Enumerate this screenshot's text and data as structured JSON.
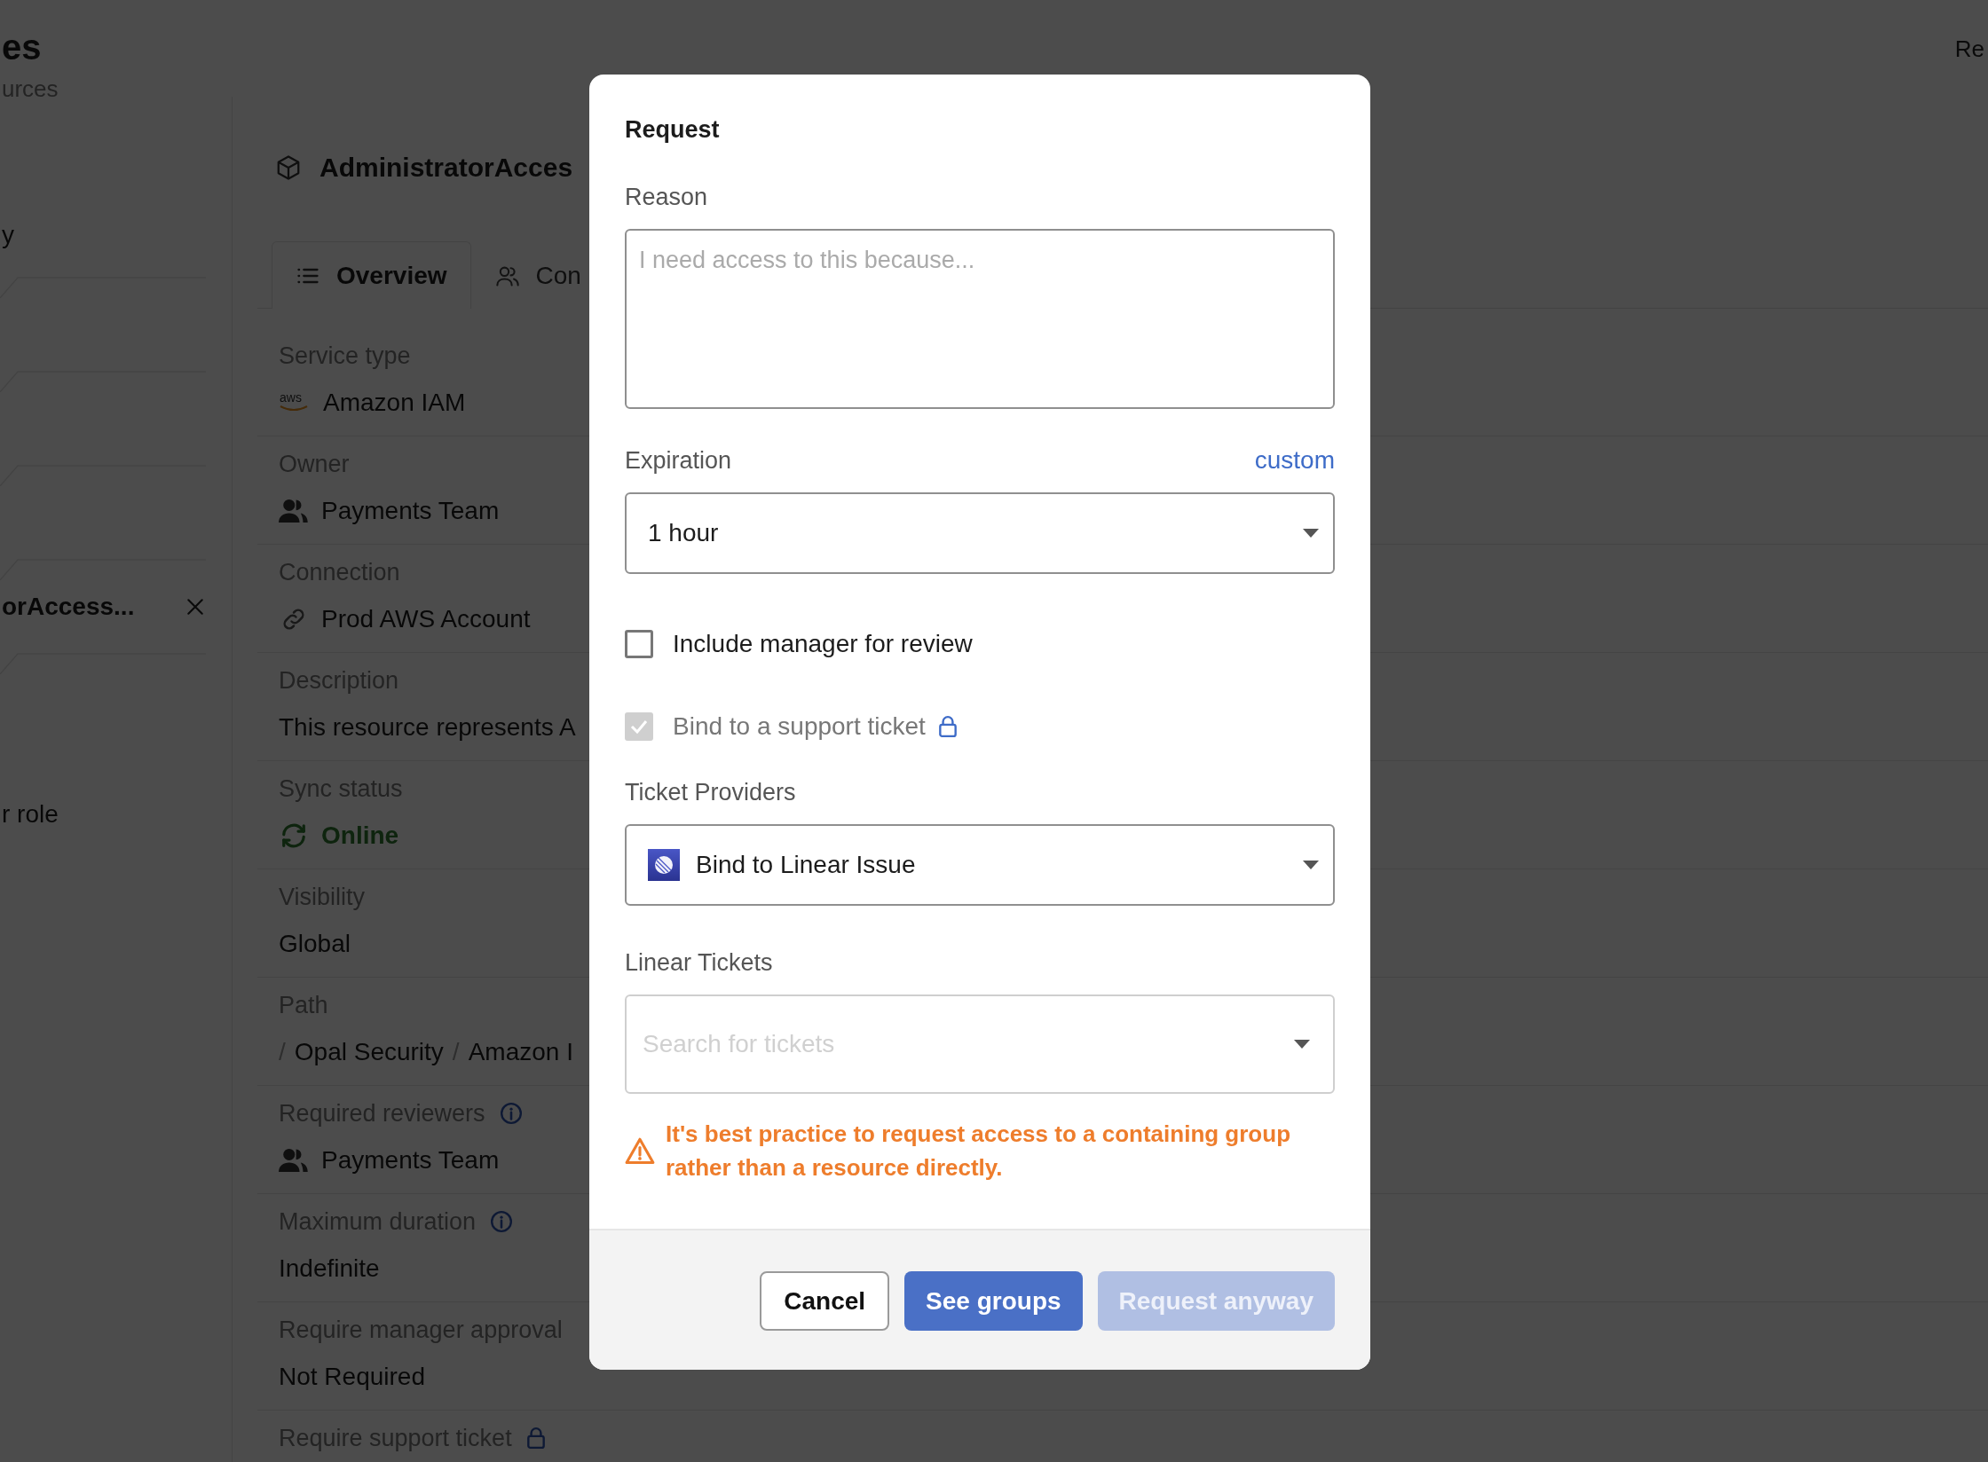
{
  "header": {
    "title": "es",
    "subtitle": "urces",
    "top_right": "Re"
  },
  "sidebar": {
    "items": [
      {
        "kind": "text",
        "label": "y"
      },
      {
        "kind": "branch"
      },
      {
        "kind": "branch"
      },
      {
        "kind": "branch"
      },
      {
        "kind": "branch",
        "label": "orAccess...",
        "selected": true
      },
      {
        "kind": "branch"
      },
      {
        "kind": "text",
        "label": "r role"
      }
    ]
  },
  "detail": {
    "title": "AdministratorAcces",
    "tabs": [
      {
        "label": "Overview",
        "selected": true
      },
      {
        "label": "Con",
        "selected": false
      }
    ],
    "fields": [
      {
        "kind": "service",
        "label": "Service type",
        "logo_text": "aws",
        "value": "Amazon IAM"
      },
      {
        "kind": "team",
        "label": "Owner",
        "value": "Payments Team"
      },
      {
        "kind": "connection",
        "label": "Connection",
        "value": "Prod AWS Account"
      },
      {
        "kind": "text",
        "label": "Description",
        "value": "This resource represents A"
      },
      {
        "kind": "status",
        "label": "Sync status",
        "value": "Online"
      },
      {
        "kind": "text",
        "label": "Visibility",
        "value": "Global"
      },
      {
        "kind": "path",
        "label": "Path",
        "parts": [
          {
            "kind": "sep",
            "text": "/"
          },
          {
            "kind": "seg",
            "text": "Opal Security"
          },
          {
            "kind": "sep",
            "text": "/"
          },
          {
            "kind": "seg",
            "text": "Amazon I"
          }
        ]
      },
      {
        "kind": "team",
        "label": "Required reviewers",
        "info": true,
        "value": "Payments Team"
      },
      {
        "kind": "text",
        "label": "Maximum duration",
        "info": true,
        "value": "Indefinite"
      },
      {
        "kind": "text",
        "label": "Require manager approval",
        "value": "Not Required"
      },
      {
        "label": "Require support ticket",
        "locked": true
      }
    ]
  },
  "modal": {
    "title": "Request",
    "reason": {
      "label": "Reason",
      "placeholder": "I need access to this because..."
    },
    "expiration": {
      "label": "Expiration",
      "link": "custom",
      "value": "1 hour"
    },
    "options": [
      {
        "label": "Include manager for review",
        "checked": false,
        "disabled": false
      },
      {
        "label": "Bind to a support ticket",
        "checked": true,
        "disabled": true,
        "locked": true
      }
    ],
    "ticket_providers": {
      "label": "Ticket Providers",
      "value": "Bind to Linear Issue"
    },
    "linear_tickets": {
      "label": "Linear Tickets",
      "placeholder": "Search for tickets"
    },
    "warning": "It's best practice to request access to a containing group rather than a resource directly.",
    "buttons": [
      {
        "label": "Cancel",
        "kind": "secondary",
        "disabled": false
      },
      {
        "label": "See groups",
        "kind": "primary",
        "disabled": false
      },
      {
        "label": "Request anyway",
        "kind": "primary",
        "disabled": true
      }
    ]
  }
}
